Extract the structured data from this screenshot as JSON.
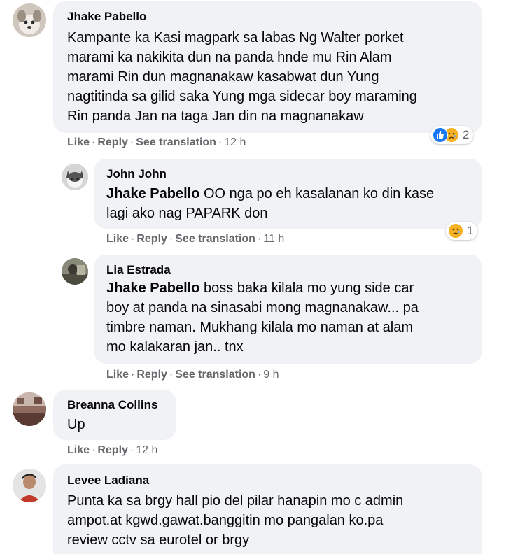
{
  "comments": [
    {
      "author": "Jhake Pabello",
      "lines": [
        "Kampante ka Kasi magpark sa labas Ng Walter porket",
        "marami ka nakikita dun na panda hnde mu Rin Alam",
        "marami Rin dun magnanakaw kasabwat dun Yung",
        "nagtitinda sa gilid saka Yung mga sidecar boy maraming",
        "Rin panda Jan na taga Jan din na magnanakaw"
      ],
      "actions": {
        "like": "Like",
        "reply": "Reply",
        "translate": "See translation",
        "time": "12 h"
      },
      "reactions": {
        "icons": [
          "like-reaction-icon",
          "sad-reaction-icon"
        ],
        "count": "2"
      }
    },
    {
      "author": "John John",
      "tag": "Jhake Pabello",
      "lines": [
        " OO nga po eh kasalanan ko din kase",
        "lagi ako nag PAPARK don"
      ],
      "actions": {
        "like": "Like",
        "reply": "Reply",
        "translate": "See translation",
        "time": "11 h"
      },
      "reactions": {
        "icons": [
          "sad-reaction-icon"
        ],
        "count": "1"
      }
    },
    {
      "author": "Lia Estrada",
      "tag": "Jhake Pabello",
      "lines": [
        " boss baka kilala mo yung side car",
        "boy at panda na sinasabi mong magnanakaw... pa",
        "timbre naman. Mukhang kilala mo naman at alam",
        "mo kalakaran jan.. tnx"
      ],
      "actions": {
        "like": "Like",
        "reply": "Reply",
        "translate": "See translation",
        "time": "9 h"
      }
    },
    {
      "author": "Breanna Collins",
      "lines": [
        "Up"
      ],
      "actions": {
        "like": "Like",
        "reply": "Reply",
        "time": "12 h"
      }
    },
    {
      "author": "Levee Ladiana",
      "lines": [
        "Punta ka sa brgy hall pio del pilar hanapin mo c admin",
        "ampot.at kgwd.gawat.banggitin mo pangalan ko.pa",
        "review cctv sa eurotel or brgy"
      ]
    }
  ],
  "separator": "·",
  "colors": {
    "bubble": "#f0f2f5",
    "meta": "#65676b",
    "like": "#1877f2",
    "sad": "#f7b125"
  }
}
